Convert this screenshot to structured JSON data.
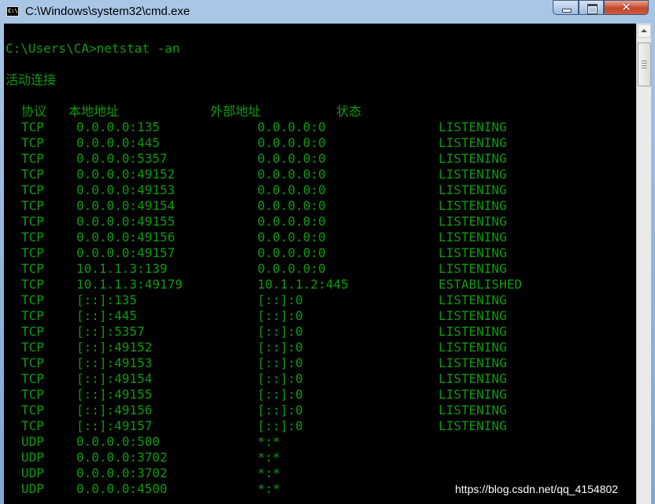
{
  "window": {
    "title": "C:\\Windows\\system32\\cmd.exe",
    "icon_label": "C:\\"
  },
  "controls": {
    "minimize": "minimize-icon",
    "maximize": "maximize-icon",
    "close": "close-icon",
    "close_glyph": "✕"
  },
  "console": {
    "command": "C:\\Users\\CA>netstat -an",
    "heading": "活动连接",
    "headers": {
      "proto": "协议",
      "local": "本地地址",
      "foreign": "外部地址",
      "state": "状态"
    },
    "rows": [
      {
        "proto": "TCP",
        "local": "0.0.0.0:135",
        "foreign": "0.0.0.0:0",
        "state": "LISTENING"
      },
      {
        "proto": "TCP",
        "local": "0.0.0.0:445",
        "foreign": "0.0.0.0:0",
        "state": "LISTENING"
      },
      {
        "proto": "TCP",
        "local": "0.0.0.0:5357",
        "foreign": "0.0.0.0:0",
        "state": "LISTENING"
      },
      {
        "proto": "TCP",
        "local": "0.0.0.0:49152",
        "foreign": "0.0.0.0:0",
        "state": "LISTENING"
      },
      {
        "proto": "TCP",
        "local": "0.0.0.0:49153",
        "foreign": "0.0.0.0:0",
        "state": "LISTENING"
      },
      {
        "proto": "TCP",
        "local": "0.0.0.0:49154",
        "foreign": "0.0.0.0:0",
        "state": "LISTENING"
      },
      {
        "proto": "TCP",
        "local": "0.0.0.0:49155",
        "foreign": "0.0.0.0:0",
        "state": "LISTENING"
      },
      {
        "proto": "TCP",
        "local": "0.0.0.0:49156",
        "foreign": "0.0.0.0:0",
        "state": "LISTENING"
      },
      {
        "proto": "TCP",
        "local": "0.0.0.0:49157",
        "foreign": "0.0.0.0:0",
        "state": "LISTENING"
      },
      {
        "proto": "TCP",
        "local": "10.1.1.3:139",
        "foreign": "0.0.0.0:0",
        "state": "LISTENING"
      },
      {
        "proto": "TCP",
        "local": "10.1.1.3:49179",
        "foreign": "10.1.1.2:445",
        "state": "ESTABLISHED"
      },
      {
        "proto": "TCP",
        "local": "[::]:135",
        "foreign": "[::]:0",
        "state": "LISTENING"
      },
      {
        "proto": "TCP",
        "local": "[::]:445",
        "foreign": "[::]:0",
        "state": "LISTENING"
      },
      {
        "proto": "TCP",
        "local": "[::]:5357",
        "foreign": "[::]:0",
        "state": "LISTENING"
      },
      {
        "proto": "TCP",
        "local": "[::]:49152",
        "foreign": "[::]:0",
        "state": "LISTENING"
      },
      {
        "proto": "TCP",
        "local": "[::]:49153",
        "foreign": "[::]:0",
        "state": "LISTENING"
      },
      {
        "proto": "TCP",
        "local": "[::]:49154",
        "foreign": "[::]:0",
        "state": "LISTENING"
      },
      {
        "proto": "TCP",
        "local": "[::]:49155",
        "foreign": "[::]:0",
        "state": "LISTENING"
      },
      {
        "proto": "TCP",
        "local": "[::]:49156",
        "foreign": "[::]:0",
        "state": "LISTENING"
      },
      {
        "proto": "TCP",
        "local": "[::]:49157",
        "foreign": "[::]:0",
        "state": "LISTENING"
      },
      {
        "proto": "UDP",
        "local": "0.0.0.0:500",
        "foreign": "*:*",
        "state": ""
      },
      {
        "proto": "UDP",
        "local": "0.0.0.0:3702",
        "foreign": "*:*",
        "state": ""
      },
      {
        "proto": "UDP",
        "local": "0.0.0.0:3702",
        "foreign": "*:*",
        "state": ""
      },
      {
        "proto": "UDP",
        "local": "0.0.0.0:4500",
        "foreign": "*:*",
        "state": ""
      }
    ]
  },
  "scrollbar": {
    "up_icon": "scroll-up-arrow-icon",
    "position": 0.0
  },
  "watermark": "https://blog.csdn.net/qq_4154802",
  "colors": {
    "console_bg": "#000000",
    "console_text": "#109910",
    "title_bar": "#a9c6e6",
    "close_button": "#c8462b"
  }
}
